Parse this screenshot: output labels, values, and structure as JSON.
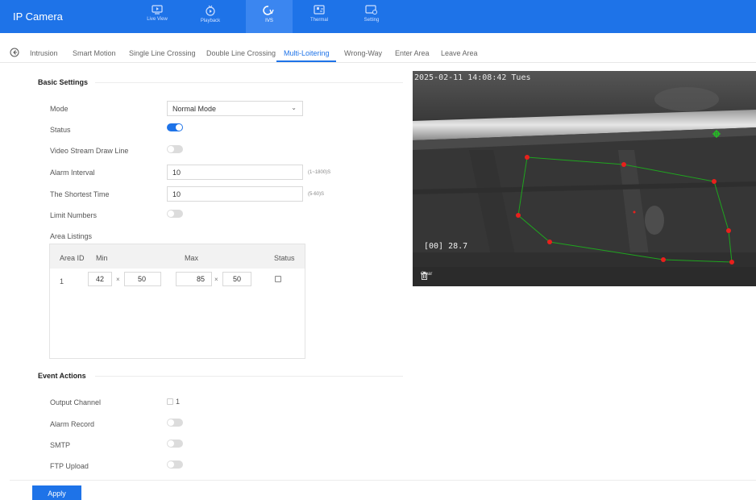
{
  "app": {
    "title": "IP Camera"
  },
  "nav": [
    {
      "label": "Live View"
    },
    {
      "label": "Playback"
    },
    {
      "label": "IVS"
    },
    {
      "label": "Thermal"
    },
    {
      "label": "Setting"
    }
  ],
  "tabs": [
    "Intrusion",
    "Smart Motion",
    "Single Line Crossing",
    "Double Line Crossing",
    "Multi-Loitering",
    "Wrong-Way",
    "Enter Area",
    "Leave Area"
  ],
  "active_tab": "Multi-Loitering",
  "basic": {
    "title": "Basic Settings",
    "mode_label": "Mode",
    "mode_value": "Normal Mode",
    "status_label": "Status",
    "status_on": true,
    "draw_line_label": "Video Stream Draw Line",
    "draw_line_on": false,
    "alarm_interval_label": "Alarm Interval",
    "alarm_interval_value": "10",
    "alarm_interval_hint": "(1~1800)S",
    "shortest_time_label": "The Shortest Time",
    "shortest_time_value": "10",
    "shortest_time_hint": "(5-60)S",
    "limit_numbers_label": "Limit Numbers",
    "limit_numbers_on": false,
    "area_listings_label": "Area Listings"
  },
  "area_table": {
    "headers": {
      "id": "Area ID",
      "min": "Min",
      "max": "Max",
      "status": "Status"
    },
    "times": "×",
    "rows": [
      {
        "id": "1",
        "min_w": "42",
        "min_h": "50",
        "max_w": "85",
        "max_h": "50",
        "status": false
      }
    ]
  },
  "events": {
    "title": "Event Actions",
    "output_channel_label": "Output Channel",
    "output_channel_value": "1",
    "alarm_record_label": "Alarm Record",
    "smtp_label": "SMTP",
    "ftp_label": "FTP Upload"
  },
  "preview": {
    "timestamp": "2025-02-11 14:08:42 Tues",
    "temperature": "[00] 28.7",
    "clear_label": "Clear",
    "polygon_color": "#1fa51f",
    "vertex_color": "#e8201c"
  },
  "apply_label": "Apply",
  "colors": {
    "accent": "#1e73e8"
  }
}
